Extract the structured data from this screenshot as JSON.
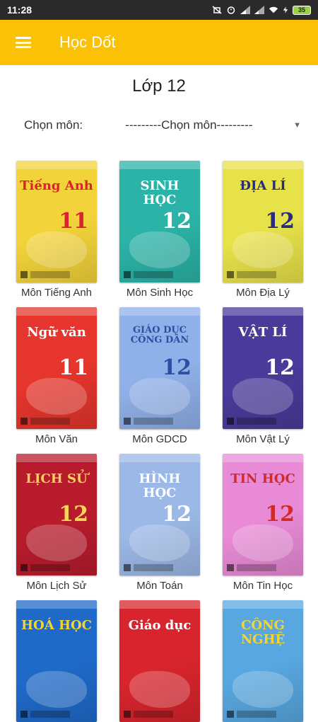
{
  "status_bar": {
    "time": "11:28",
    "battery": "35"
  },
  "app_bar": {
    "title": "Học Dốt",
    "menu_icon": "hamburger-menu-icon"
  },
  "page": {
    "title": "Lớp 12"
  },
  "subject_filter": {
    "label": "Chọn môn:",
    "selected": "---------Chọn môn---------"
  },
  "books": [
    {
      "label": "Môn Tiếng Anh",
      "cover_title": "Tiếng Anh",
      "cover_num": "11",
      "bg": "#f3d33a",
      "accent": "#d9232e"
    },
    {
      "label": "Môn Sinh Học",
      "cover_title": "SINH HỌC",
      "cover_num": "12",
      "bg": "#2bb3a7",
      "accent": "#ffffff"
    },
    {
      "label": "Môn Địa Lý",
      "cover_title": "ĐỊA LÍ",
      "cover_num": "12",
      "bg": "#e8e24a",
      "accent": "#2b2b7a"
    },
    {
      "label": "Môn Văn",
      "cover_title": "Ngữ văn",
      "cover_num": "11",
      "bg": "#e5352c",
      "accent": "#ffffff"
    },
    {
      "label": "Môn GDCD",
      "cover_title": "GIÁO DỤC CÔNG DÂN",
      "cover_num": "12",
      "bg": "#8fb0e8",
      "accent": "#2b4fa3"
    },
    {
      "label": "Môn Vật Lý",
      "cover_title": "VẬT LÍ",
      "cover_num": "12",
      "bg": "#4a3a9a",
      "accent": "#ffffff"
    },
    {
      "label": "Môn Lịch Sử",
      "cover_title": "LỊCH SỬ",
      "cover_num": "12",
      "bg": "#b81c2c",
      "accent": "#f6d35a"
    },
    {
      "label": "Môn Toán",
      "cover_title": "HÌNH HỌC",
      "cover_num": "12",
      "bg": "#9bb8e6",
      "accent": "#ffffff"
    },
    {
      "label": "Môn Tin Học",
      "cover_title": "TIN HỌC",
      "cover_num": "12",
      "bg": "#e88ad6",
      "accent": "#d12a2a"
    },
    {
      "label": "",
      "cover_title": "HOÁ HỌC",
      "cover_num": "",
      "bg": "#1f6ac9",
      "accent": "#f3d33a"
    },
    {
      "label": "",
      "cover_title": "Giáo dục",
      "cover_num": "",
      "bg": "#d8242c",
      "accent": "#ffffff"
    },
    {
      "label": "",
      "cover_title": "CÔNG NGHỆ",
      "cover_num": "",
      "bg": "#58a7e0",
      "accent": "#f3d33a"
    }
  ]
}
